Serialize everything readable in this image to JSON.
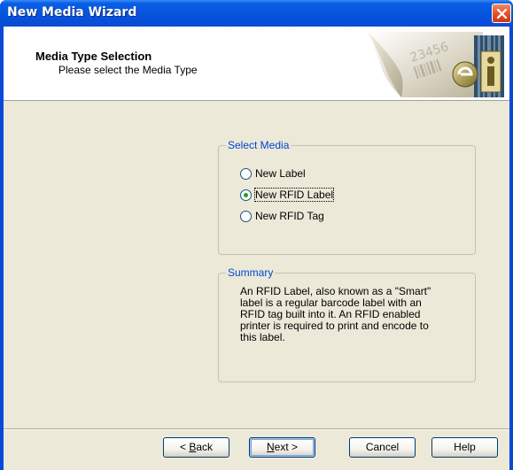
{
  "window": {
    "title": "New Media Wizard"
  },
  "header": {
    "title": "Media Type Selection",
    "subtitle": "Please select the Media Type",
    "graphic_digits": "23456"
  },
  "select_media": {
    "label": "Select Media",
    "options": [
      {
        "label": "New Label",
        "selected": false
      },
      {
        "label": "New RFID Label",
        "selected": true
      },
      {
        "label": "New RFID Tag",
        "selected": false
      }
    ]
  },
  "summary": {
    "label": "Summary",
    "lines": [
      "An RFID Label, also known as a \"Smart\"",
      "label is a regular barcode label with an",
      "RFID tag built into it.  An RFID enabled",
      "printer is required to print and encode to",
      "this label."
    ]
  },
  "buttons": {
    "back": {
      "prefix": "< ",
      "mnemonic": "B",
      "rest": "ack"
    },
    "next": {
      "mnemonic": "N",
      "rest": "ext >"
    },
    "cancel": "Cancel",
    "help": "Help"
  },
  "colors": {
    "title_bar": "#0755de",
    "dialog_bg": "#ece9d8",
    "group_label": "#0046d5",
    "radio_dot": "#21a121"
  },
  "icons": {
    "close": "close-icon",
    "wizard_graphic": "media-wizard-logo-icon"
  }
}
